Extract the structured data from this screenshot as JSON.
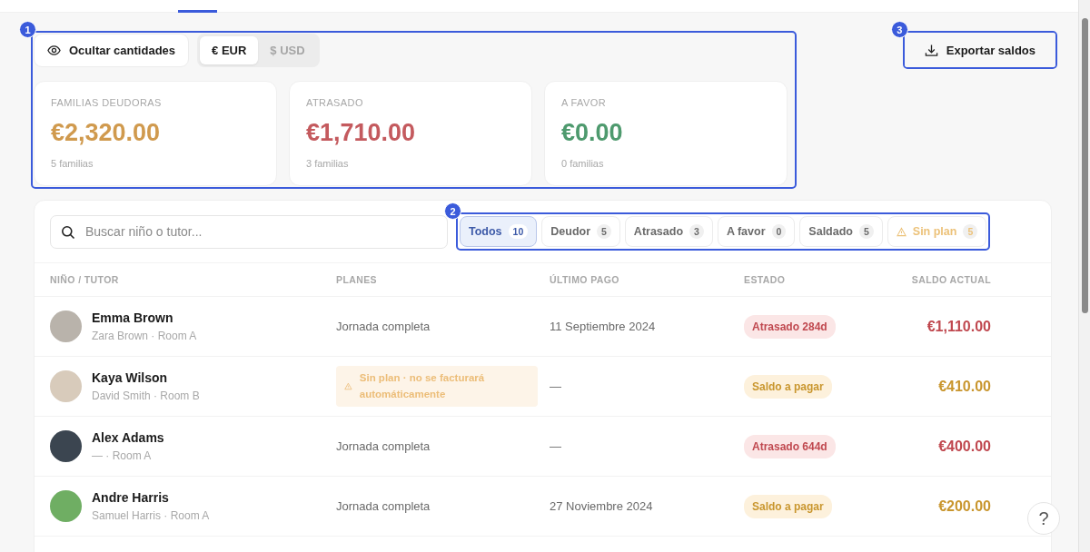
{
  "nav": {
    "active_indicator": true
  },
  "callouts": [
    {
      "number": "1"
    },
    {
      "number": "2"
    },
    {
      "number": "3"
    }
  ],
  "toolbar": {
    "hide_button": "Ocultar cantidades",
    "currency": [
      {
        "label": "€ EUR",
        "selected": true
      },
      {
        "label": "$ USD",
        "selected": false
      }
    ],
    "export_button": "Exportar saldos"
  },
  "stats": [
    {
      "label": "FAMILIAS DEUDORAS",
      "value": "€2,320.00",
      "sub": "5 familias",
      "color": "#d09a4e"
    },
    {
      "label": "ATRASADO",
      "value": "€1,710.00",
      "sub": "3 familias",
      "color": "#c45a5e"
    },
    {
      "label": "A FAVOR",
      "value": "€0.00",
      "sub": "0 familias",
      "color": "#4e9a6e"
    }
  ],
  "search": {
    "placeholder": "Buscar niño o tutor..."
  },
  "filters": [
    {
      "label": "Todos",
      "count": "10",
      "selected": true,
      "kind": "normal"
    },
    {
      "label": "Deudor",
      "count": "5",
      "selected": false,
      "kind": "normal"
    },
    {
      "label": "Atrasado",
      "count": "3",
      "selected": false,
      "kind": "normal"
    },
    {
      "label": "A favor",
      "count": "0",
      "selected": false,
      "kind": "normal"
    },
    {
      "label": "Saldado",
      "count": "5",
      "selected": false,
      "kind": "normal"
    },
    {
      "label": "Sin plan",
      "count": "5",
      "selected": false,
      "kind": "warning"
    }
  ],
  "table": {
    "columns": [
      "NIÑO / TUTOR",
      "PLANES",
      "ÚLTIMO PAGO",
      "ESTADO",
      "SALDO ACTUAL"
    ],
    "rows": [
      {
        "name": "Emma Brown",
        "sub": "Zara Brown · Room A",
        "plan": {
          "kind": "plan",
          "text": "Jornada completa"
        },
        "last_payment": "11 Septiembre 2024",
        "status": {
          "kind": "overdue",
          "text": "Atrasado 284d"
        },
        "balance": "€1,110.00"
      },
      {
        "name": "Kaya Wilson",
        "sub": "David Smith · Room B",
        "plan": {
          "kind": "none",
          "text": "Sin plan · no se facturará automáticamente"
        },
        "last_payment": "—",
        "status": {
          "kind": "due",
          "text": "Saldo a pagar"
        },
        "balance": "€410.00"
      },
      {
        "name": "Alex Adams",
        "sub": "— · Room A",
        "plan": {
          "kind": "plan",
          "text": "Jornada completa"
        },
        "last_payment": "—",
        "status": {
          "kind": "overdue",
          "text": "Atrasado 644d"
        },
        "balance": "€400.00"
      },
      {
        "name": "Andre Harris",
        "sub": "Samuel Harris · Room A",
        "plan": {
          "kind": "plan",
          "text": "Jornada completa"
        },
        "last_payment": "27 Noviembre 2024",
        "status": {
          "kind": "due",
          "text": "Saldo a pagar"
        },
        "balance": "€200.00"
      }
    ]
  },
  "help_button": "?"
}
